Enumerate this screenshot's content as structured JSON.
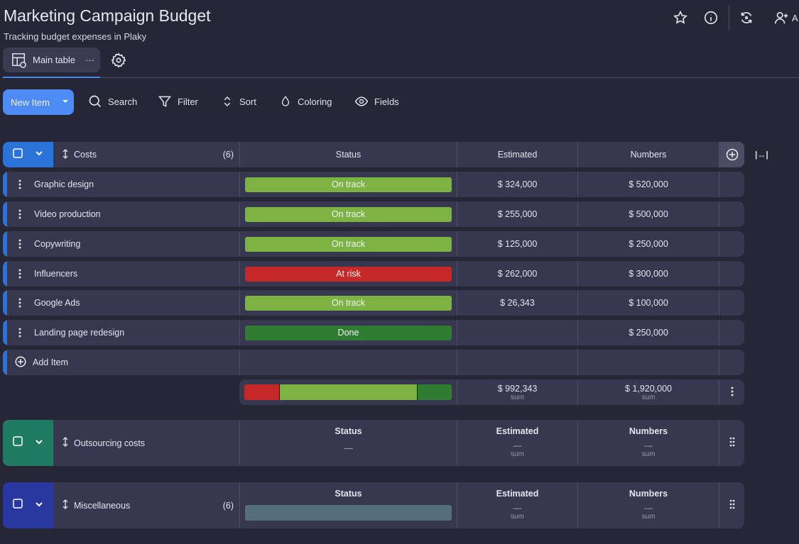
{
  "header": {
    "title": "Marketing Campaign Budget",
    "subtitle": "Tracking budget expenses in Plaky",
    "add_user_label": "A"
  },
  "tabs": [
    {
      "label": "Main table"
    }
  ],
  "toolbar": {
    "new_item": "New Item",
    "search": "Search",
    "filter": "Filter",
    "sort": "Sort",
    "coloring": "Coloring",
    "fields": "Fields"
  },
  "colors": {
    "accent": "#4d8cf5",
    "on_track": "#7cb342",
    "at_risk": "#c62828",
    "done": "#2e7d32",
    "empty": "#546e7a"
  },
  "columns": {
    "status": "Status",
    "estimated": "Estimated",
    "numbers": "Numbers"
  },
  "groups": [
    {
      "name": "Costs",
      "count": "(6)",
      "color": "#2a73d9",
      "items": [
        {
          "name": "Graphic design",
          "status": "On track",
          "status_key": "on_track",
          "estimated": "$ 324,000",
          "numbers": "$ 520,000"
        },
        {
          "name": "Video production",
          "status": "On track",
          "status_key": "on_track",
          "estimated": "$ 255,000",
          "numbers": "$ 500,000"
        },
        {
          "name": "Copywriting",
          "status": "On track",
          "status_key": "on_track",
          "estimated": "$ 125,000",
          "numbers": "$ 250,000"
        },
        {
          "name": "Influencers",
          "status": "At risk",
          "status_key": "at_risk",
          "estimated": "$ 262,000",
          "numbers": "$ 300,000"
        },
        {
          "name": "Google Ads",
          "status": "On track",
          "status_key": "on_track",
          "estimated": "$ 26,343",
          "numbers": "$ 100,000"
        },
        {
          "name": "Landing page redesign",
          "status": "Done",
          "status_key": "done",
          "estimated": "",
          "numbers": "$ 250,000"
        }
      ],
      "add_item": "Add Item",
      "summary": {
        "status_distribution": [
          {
            "key": "at_risk",
            "count": 1
          },
          {
            "key": "on_track",
            "count": 4
          },
          {
            "key": "done",
            "count": 1
          }
        ],
        "estimated": "$ 992,343",
        "numbers": "$ 1,920,000",
        "label": "sum"
      }
    },
    {
      "name": "Outsourcing costs",
      "count": "",
      "color": "#217a62",
      "summary": {
        "status": "—",
        "estimated": "—",
        "numbers": "—",
        "label": "sum"
      }
    },
    {
      "name": "Miscellaneous",
      "count": "(6)",
      "color": "#2838a0",
      "summary": {
        "status": "",
        "estimated": "—",
        "numbers": "—",
        "label": "sum"
      }
    }
  ]
}
